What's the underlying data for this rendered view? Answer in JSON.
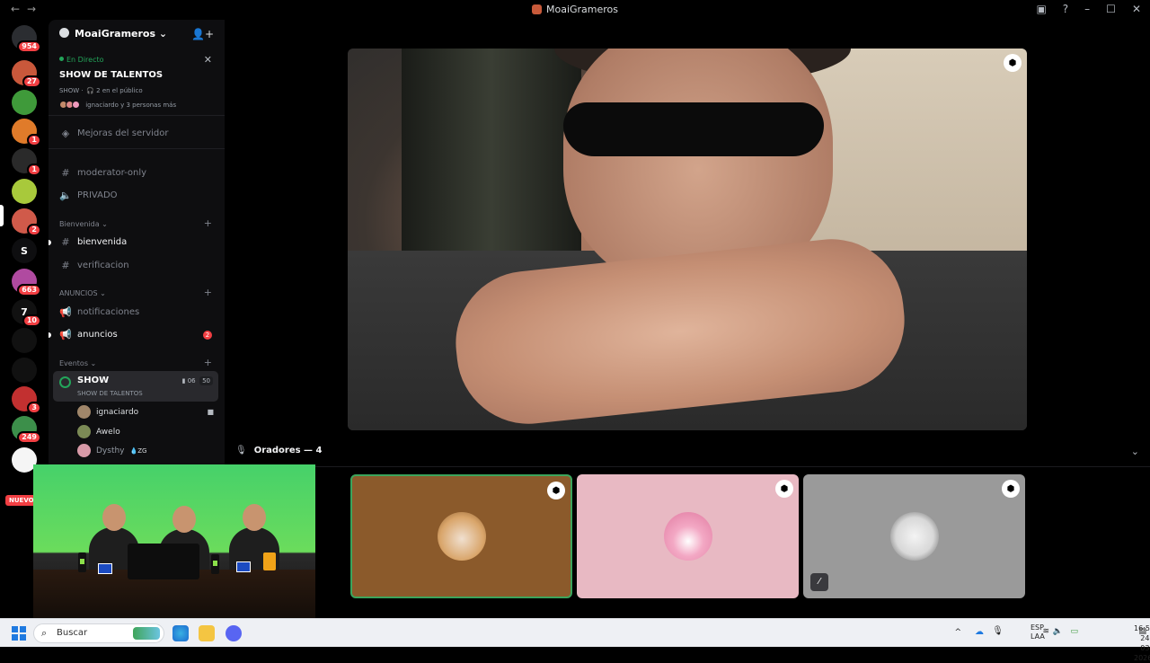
{
  "window": {
    "title": "MoaiGrameros"
  },
  "servers": [
    {
      "name": "home",
      "badge": "954",
      "color": "#2b2d31"
    },
    {
      "name": "server-2",
      "badge": "27",
      "color": "#c9583b"
    },
    {
      "name": "server-3",
      "badge": "",
      "color": "#3f9a3a"
    },
    {
      "name": "server-4",
      "badge": "1",
      "color": "#e07b2a"
    },
    {
      "name": "server-5",
      "badge": "1",
      "color": "#2a2a2a"
    },
    {
      "name": "server-6",
      "badge": "",
      "color": "#a8c93b"
    },
    {
      "name": "moaigrameros",
      "badge": "2",
      "color": "#d05a4a"
    },
    {
      "name": "S",
      "badge": "",
      "color": "#0e0e10"
    },
    {
      "name": "server-9",
      "badge": "663",
      "color": "#b04aa0"
    },
    {
      "name": "7",
      "badge": "10",
      "color": "#111"
    },
    {
      "name": "laGHEM",
      "badge": "",
      "color": "#111"
    },
    {
      "name": "ELITE",
      "badge": "",
      "color": "#111"
    },
    {
      "name": "server-13",
      "badge": "3",
      "color": "#c23030"
    },
    {
      "name": "server-14",
      "badge": "249",
      "color": "#3c8f4a"
    },
    {
      "name": "GAMERS X LA CAUSA",
      "badge": "",
      "color": "#f5f5f5"
    }
  ],
  "sidebar": {
    "server_name": "MoaiGrameros",
    "live": {
      "status": "En Directo",
      "title": "SHOW DE TALENTOS",
      "meta": "SHOW ·  🎧 2 en el público",
      "users": "ignaciardo y 3 personas más"
    },
    "boosts": "Mejoras del servidor",
    "channels_top": [
      {
        "icon": "#",
        "label": "moderator-only"
      },
      {
        "icon": "🔈",
        "label": "PRIVADO"
      }
    ],
    "cat_bienvenida": "Bienvenida",
    "bienvenida_channels": [
      {
        "icon": "#",
        "label": "bienvenida"
      },
      {
        "icon": "#",
        "label": "verificacion"
      }
    ],
    "cat_anuncios": "ANUNCIOS",
    "anuncios_channels": [
      {
        "icon": "📢",
        "label": "notificaciones"
      },
      {
        "icon": "📢",
        "label": "anuncios",
        "badge": "2"
      }
    ],
    "cat_eventos": "Eventos",
    "show": {
      "name": "SHOW",
      "subtitle": "SHOW DE TALENTOS",
      "cam": "06",
      "count": "50"
    },
    "members": [
      {
        "name": "ignaciardo",
        "color": "#a0866a"
      },
      {
        "name": "Awelo",
        "color": "#7b8a55"
      },
      {
        "name": "Dysthy",
        "tag": "ZG",
        "color": "#d89aa8"
      }
    ],
    "new_label": "NUEVO"
  },
  "stage": {
    "speakers_label": "Oradores — 4",
    "tiles": [
      {
        "name": "speaker-cat",
        "bg": "#8b5a2b",
        "highlight": true,
        "avatar": "#d9a56a"
      },
      {
        "name": "speaker-pink",
        "bg": "#e8b9c3",
        "highlight": false,
        "avatar": "#f3a8c4"
      },
      {
        "name": "speaker-gray",
        "bg": "#9a9a9a",
        "highlight": false,
        "avatar": "#e6e6e6",
        "muted": true
      }
    ]
  },
  "taskbar": {
    "search_placeholder": "Buscar",
    "lang_top": "ESP",
    "lang_bottom": "LAA",
    "time": "16:50",
    "date": "24-03-2026"
  }
}
